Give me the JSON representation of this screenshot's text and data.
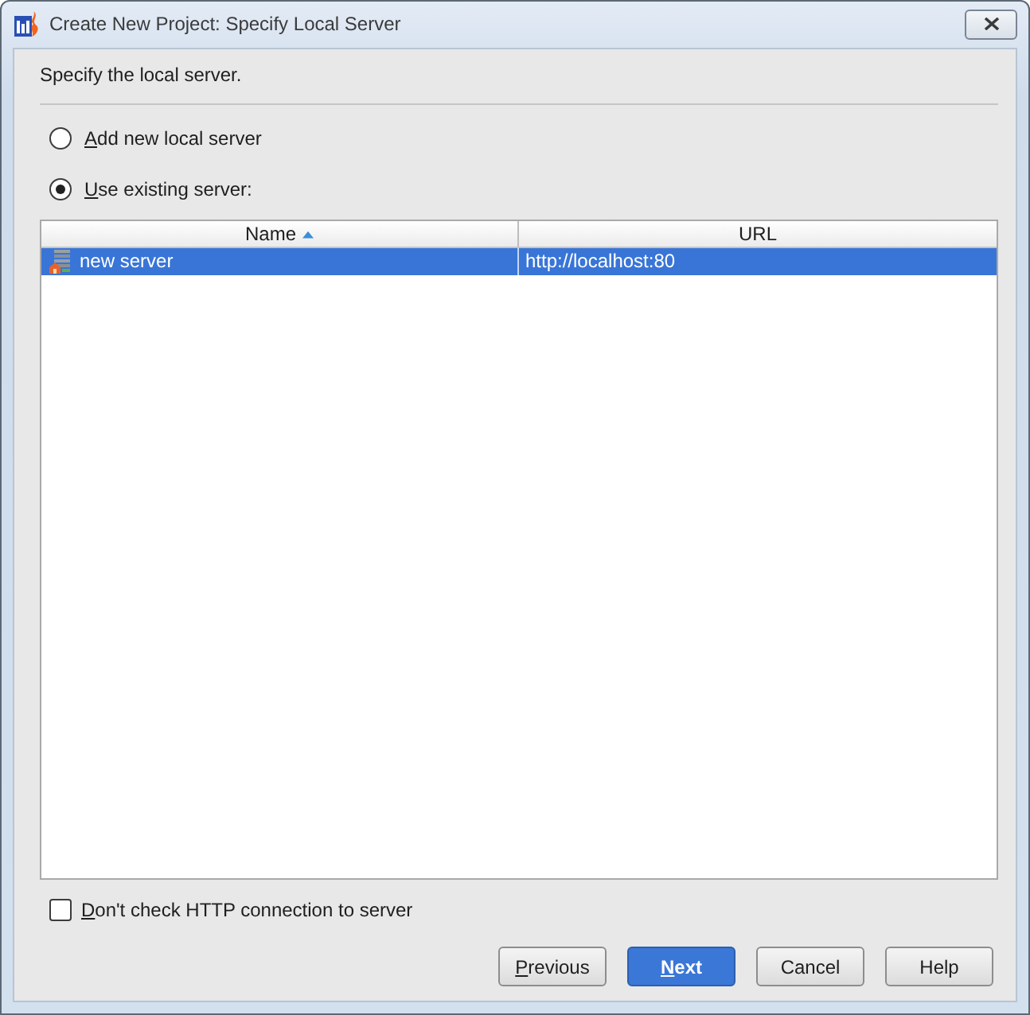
{
  "window": {
    "title": "Create New Project: Specify Local Server"
  },
  "instruction": "Specify the local server.",
  "server_options": [
    {
      "label": "Add new local server",
      "selected": false,
      "mnemonic_first_letter": true
    },
    {
      "label": "Use existing server:",
      "selected": true,
      "mnemonic_first_letter": true
    }
  ],
  "servers_table": {
    "columns": [
      {
        "label": "Name",
        "sorted": true,
        "descending": false
      },
      {
        "label": "URL",
        "sorted": false
      }
    ],
    "rows": [
      {
        "cells": [
          "new server",
          "http://localhost:80"
        ],
        "selected": true
      }
    ]
  },
  "options": [
    {
      "label": "Don't check HTTP connection to server",
      "checked": false,
      "mnemonic_first_letter": true
    }
  ],
  "buttons": [
    {
      "label": "Previous",
      "default": false,
      "mnemonic_first_letter": true
    },
    {
      "label": "Next",
      "default": true,
      "mnemonic_first_letter": true
    },
    {
      "label": "Cancel",
      "default": false,
      "mnemonic_first_letter": false
    },
    {
      "label": "Help",
      "default": false,
      "mnemonic_first_letter": false
    }
  ]
}
